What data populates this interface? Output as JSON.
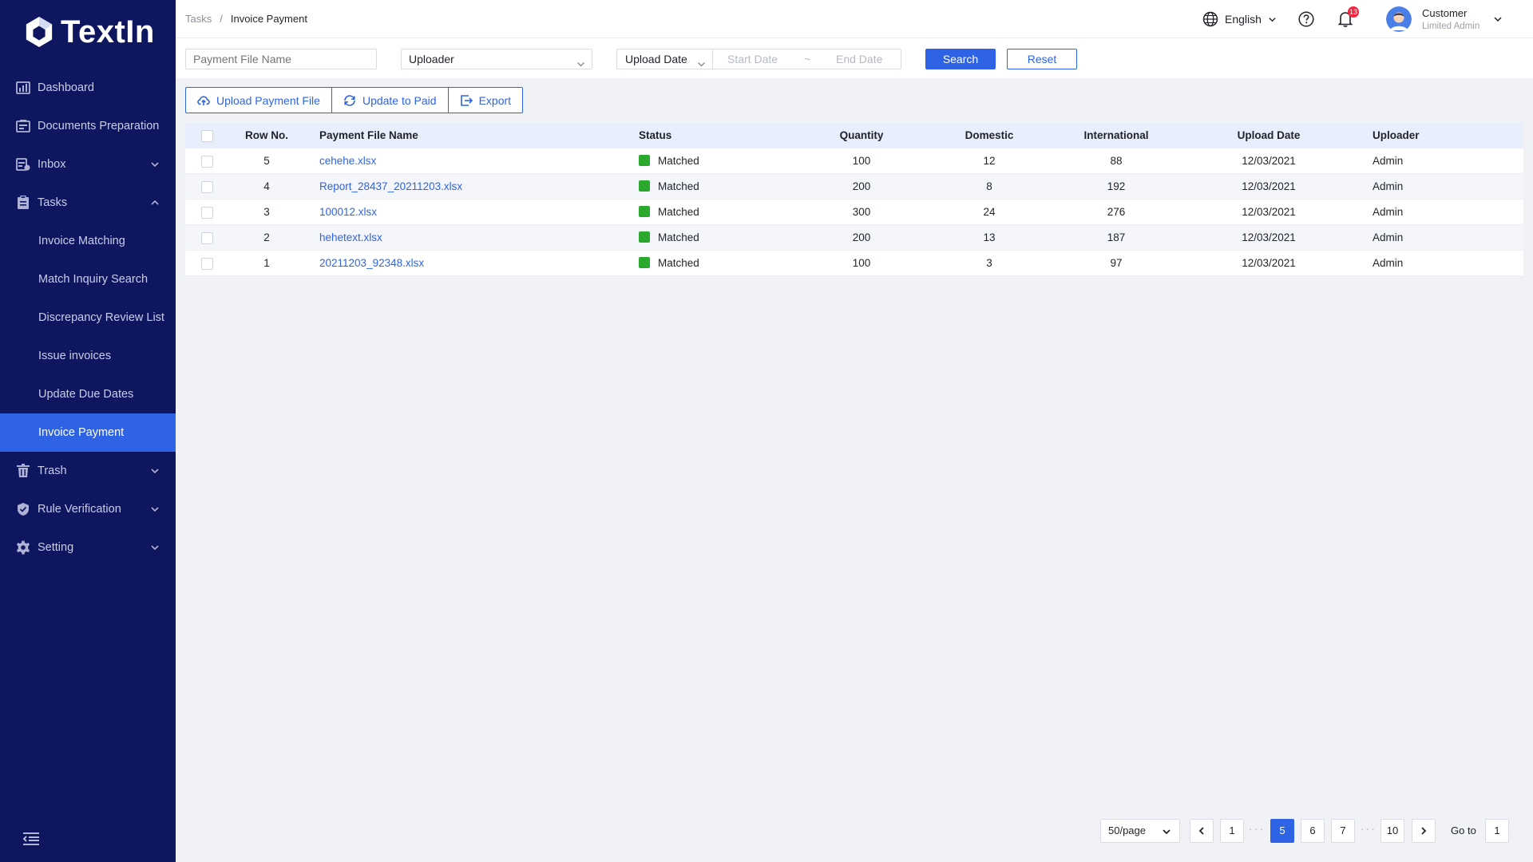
{
  "app": {
    "logo_text": "TextIn"
  },
  "sidebar": {
    "items": [
      {
        "label": "Dashboard",
        "icon": "dashboard-icon"
      },
      {
        "label": "Documents Preparation",
        "icon": "documents-icon"
      },
      {
        "label": "Inbox",
        "icon": "inbox-icon"
      },
      {
        "label": "Tasks",
        "icon": "clipboard-icon"
      },
      {
        "label": "Trash",
        "icon": "trash-icon"
      },
      {
        "label": "Rule Verification",
        "icon": "shield-check-icon"
      },
      {
        "label": "Setting",
        "icon": "gear-icon"
      }
    ],
    "tasks_sub": [
      {
        "label": "Invoice Matching"
      },
      {
        "label": "Match Inquiry Search"
      },
      {
        "label": "Discrepancy Review List"
      },
      {
        "label": "Issue invoices"
      },
      {
        "label": "Update Due Dates"
      },
      {
        "label": "Invoice Payment"
      }
    ]
  },
  "header": {
    "breadcrumb": [
      "Tasks",
      "Invoice Payment"
    ],
    "language": "English",
    "notifications": "13",
    "user_name": "Customer",
    "user_role": "Limited Admin"
  },
  "filters": {
    "file_name_placeholder": "Payment File Name",
    "uploader_value": "Uploader",
    "date_type": "Upload Date",
    "start_placeholder": "Start Date",
    "range_sep": "~",
    "end_placeholder": "End Date",
    "search_label": "Search",
    "reset_label": "Reset"
  },
  "toolbar": {
    "upload_label": "Upload Payment File",
    "update_label": "Update to Paid",
    "export_label": "Export"
  },
  "table": {
    "columns": [
      "Row No.",
      "Payment File Name",
      "Status",
      "Quantity",
      "Domestic",
      "International",
      "Upload Date",
      "Uploader"
    ],
    "rows": [
      {
        "row_no": "5",
        "file": "cehehe.xlsx",
        "status": "Matched",
        "quantity": "100",
        "domestic": "12",
        "international": "88",
        "date": "12/03/2021",
        "uploader": "Admin"
      },
      {
        "row_no": "4",
        "file": "Report_28437_20211203.xlsx",
        "status": "Matched",
        "quantity": "200",
        "domestic": "8",
        "international": "192",
        "date": "12/03/2021",
        "uploader": "Admin"
      },
      {
        "row_no": "3",
        "file": "100012.xlsx",
        "status": "Matched",
        "quantity": "300",
        "domestic": "24",
        "international": "276",
        "date": "12/03/2021",
        "uploader": "Admin"
      },
      {
        "row_no": "2",
        "file": "hehetext.xlsx",
        "status": "Matched",
        "quantity": "200",
        "domestic": "13",
        "international": "187",
        "date": "12/03/2021",
        "uploader": "Admin"
      },
      {
        "row_no": "1",
        "file": "20211203_92348.xlsx",
        "status": "Matched",
        "quantity": "100",
        "domestic": "3",
        "international": "97",
        "date": "12/03/2021",
        "uploader": "Admin"
      }
    ],
    "status_color": "#2ba82e"
  },
  "pagination": {
    "page_size": "50/page",
    "pages": [
      "1",
      "5",
      "6",
      "7",
      "10"
    ],
    "current": "5",
    "dots": "···",
    "goto_label": "Go to",
    "goto_value": "1"
  },
  "colors": {
    "sidebar_bg": "#0e1660",
    "accent": "#2e63e6"
  }
}
